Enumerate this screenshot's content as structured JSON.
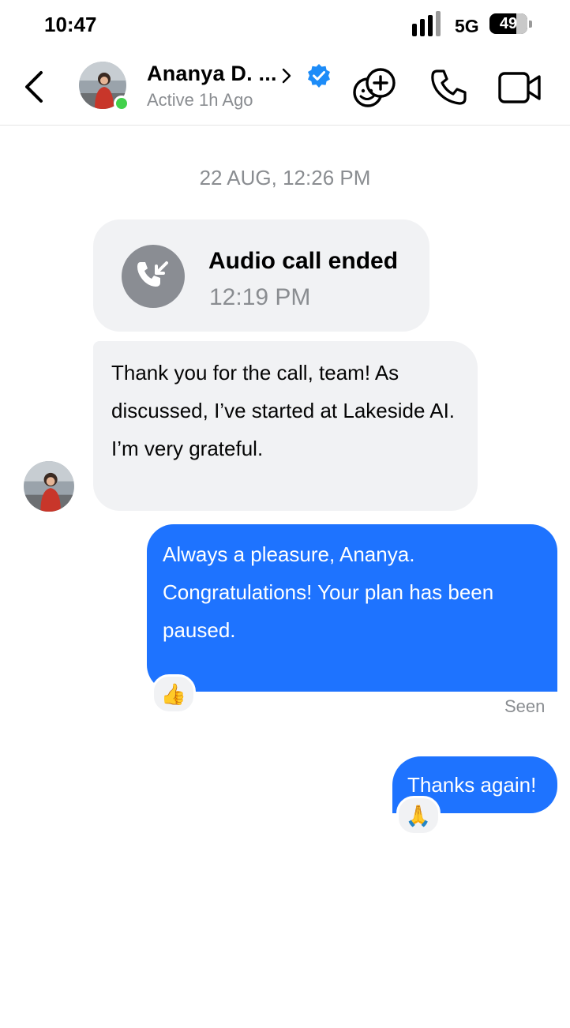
{
  "status_bar": {
    "time": "10:47",
    "network": "5G",
    "battery": "49"
  },
  "header": {
    "contact_name": "Ananya D. ...",
    "presence": "Active 1h Ago",
    "icons": [
      "back-icon",
      "chevron-right-icon",
      "verified-icon",
      "sticker-add-icon",
      "phone-icon",
      "video-icon"
    ]
  },
  "thread": {
    "date": "22 AUG, 12:26 PM",
    "call": {
      "title": "Audio call ended",
      "time": "12:19 PM"
    },
    "messages": [
      {
        "sender": "contact",
        "text": "Thank you for the call, team! As discussed, I’ve started at Lakeside AI. I’m very grateful."
      },
      {
        "sender": "me",
        "text": "Always a pleasure, Ananya. Congratulations! Your plan has been paused.",
        "reaction": "👍"
      },
      {
        "sender": "me",
        "text": "Thanks again!",
        "reaction": "🙏"
      }
    ],
    "receipt": "Seen"
  },
  "colors": {
    "accent": "#1e73ff",
    "bubble_in": "#f1f2f4",
    "online": "#42d14b",
    "muted": "#8a8d91"
  }
}
